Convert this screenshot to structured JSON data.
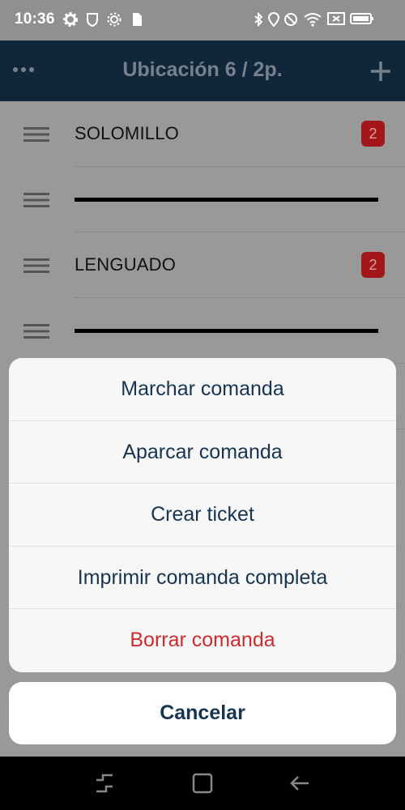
{
  "status_bar": {
    "time": "10:36",
    "left_icons": [
      "gear-icon",
      "shield-icon",
      "settings-icon",
      "sim-icon"
    ],
    "right_icons": [
      "bluetooth-icon",
      "location-icon",
      "dnd-icon",
      "wifi-icon",
      "cast-icon",
      "battery-icon"
    ]
  },
  "app_bar": {
    "title": "Ubicación 6 / 2p.",
    "left_icon": "more-icon",
    "right_icon": "plus-icon",
    "background": "#10263a"
  },
  "list": {
    "items": [
      {
        "label": "SOLOMILLO",
        "badge": "2"
      },
      {
        "label": "",
        "strike": true
      },
      {
        "label": "LENGUADO",
        "badge": "2"
      },
      {
        "label": "",
        "strike": true
      }
    ]
  },
  "action_sheet": {
    "options": [
      {
        "label": "Marchar comanda"
      },
      {
        "label": "Aparcar comanda"
      },
      {
        "label": "Crear ticket"
      },
      {
        "label": "Imprimir comanda completa"
      },
      {
        "label": "Borrar comanda",
        "destructive": true
      }
    ],
    "cancel_label": "Cancelar",
    "text_color": "#163552",
    "destructive_color": "#cf2b2b"
  },
  "nav_bar": {
    "icons": [
      "recents-icon",
      "home-icon",
      "back-icon"
    ]
  }
}
